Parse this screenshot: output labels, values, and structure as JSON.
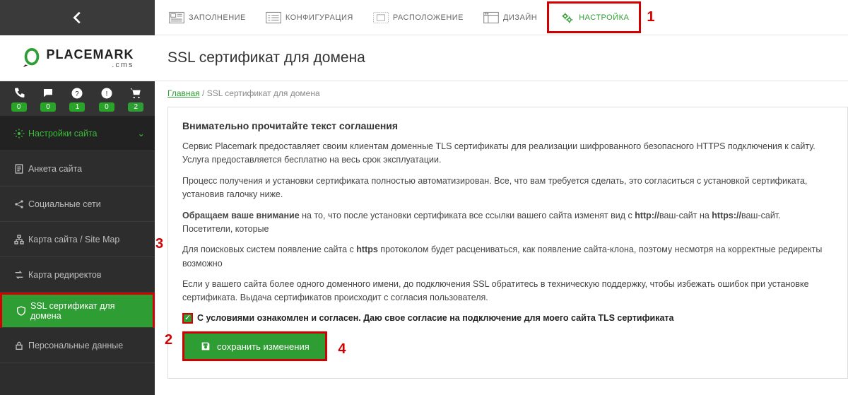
{
  "brand": {
    "name": "PLACEMARK",
    "sub": ".cms"
  },
  "toolbar": {
    "fill": "ЗАПОЛНЕНИЕ",
    "config": "КОНФИГУРАЦИЯ",
    "layout": "РАСПОЛОЖЕНИЕ",
    "design": "ДИЗАЙН",
    "settings": "НАСТРОЙКА"
  },
  "annotations": {
    "a1": "1",
    "a2": "2",
    "a3": "3",
    "a4": "4"
  },
  "iconbar": {
    "phone": "0",
    "chat": "0",
    "help": "1",
    "warn": "0",
    "cart": "2"
  },
  "sidebar": {
    "items": [
      {
        "label": "Настройки сайта"
      },
      {
        "label": "Анкета сайта"
      },
      {
        "label": "Социальные сети"
      },
      {
        "label": "Карта сайта / Site Map"
      },
      {
        "label": "Карта редиректов"
      },
      {
        "label": "SSL сертификат для домена"
      },
      {
        "label": "Персональные данные"
      }
    ]
  },
  "page": {
    "title": "SSL сертификат для домена",
    "breadcrumb_home": "Главная",
    "breadcrumb_sep": "  /  ",
    "breadcrumb_cur": "SSL сертификат для домена",
    "h3": "Внимательно прочитайте текст соглашения",
    "p1": "Сервис Placemark предоставляет своим клиентам доменные TLS сертификаты для реализации шифрованного безопасного HTTPS подключения к сайту. Услуга предоставляется бесплатно на весь срок эксплуатации.",
    "p2": "Процесс получения и установки сертификата полностью автоматизирован. Все, что вам требуется сделать, это согласиться с установкой сертификата, установив галочку ниже.",
    "p3a": "Обращаем ваше внимание",
    "p3b": " на то, что после установки сертификата все ссылки вашего сайта изменят вид с ",
    "p3c": "http://",
    "p3d": "ваш-сайт на ",
    "p3e": "https://",
    "p3f": "ваш-сайт. Посетители, которые",
    "p4a": "Для поисковых систем появление сайта с ",
    "p4b": "https",
    "p4c": " протоколом будет расцениваться, как появление сайта-клона, поэтому несмотря на корректные редиректы возможно",
    "p5": "Если у вашего сайта более одного доменного имени, до подключения SSL обратитесь в техническую поддержку, чтобы избежать ошибок при установке сертификата. Выдача сертификатов происходит с согласия пользователя.",
    "agree": "С условиями ознакомлен и согласен. Даю свое согласие на подключение для моего сайта TLS сертификата",
    "save": "сохранить изменения"
  }
}
